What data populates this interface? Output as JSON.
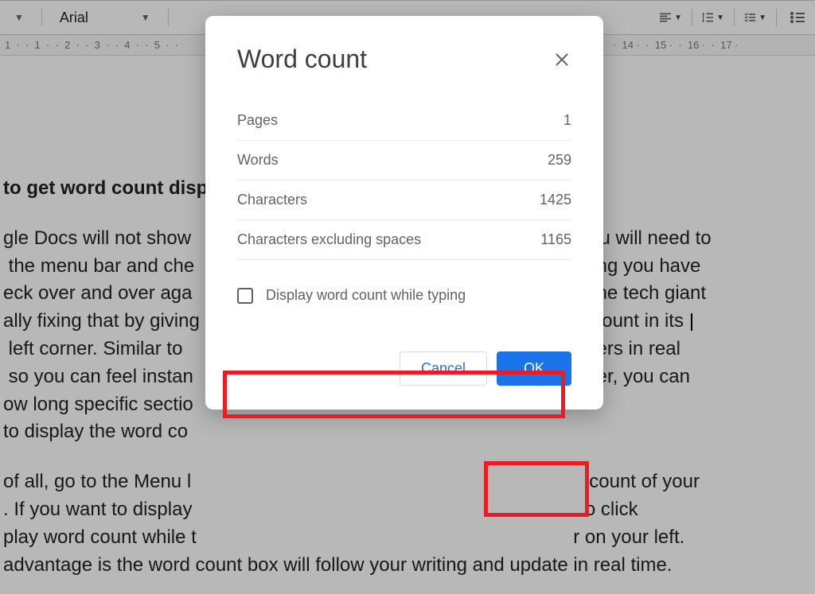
{
  "toolbar": {
    "font": "Arial"
  },
  "ruler": {
    "marks": [
      "1",
      "1",
      "2",
      "3",
      "4",
      "5",
      "14",
      "15",
      "16",
      "17"
    ]
  },
  "document": {
    "heading": "to get word count disp",
    "para1": "gle Docs will not show              u will need to  the menu bar and che              ting you have eck over and over aga              The tech giant ally fixing that by giving              d count in its  left corner. Similar to              bers in real  so you can feel instan              ther, you can ow long specific sectio to display the word co",
    "para2": "of all, go to the Menu l              count of your . If you want to display              o click play word count while t              r on your left. advantage is the word count box will follow your writing and update in real time."
  },
  "modal": {
    "title": "Word count",
    "rows": [
      {
        "label": "Pages",
        "value": "1"
      },
      {
        "label": "Words",
        "value": "259"
      },
      {
        "label": "Characters",
        "value": "1425"
      },
      {
        "label": "Characters excluding spaces",
        "value": "1165"
      }
    ],
    "checkbox_label": "Display word count while typing",
    "cancel": "Cancel",
    "ok": "OK"
  }
}
